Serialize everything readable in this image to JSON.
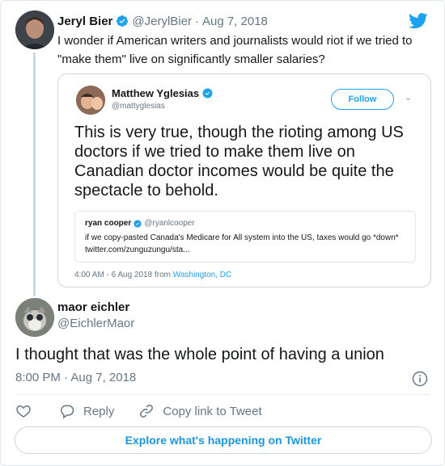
{
  "parent_tweet": {
    "author_name": "Jeryl Bier",
    "handle": "@JerylBier",
    "separator": "·",
    "date": "Aug 7, 2018",
    "text": "I wonder if American writers and journalists would riot if we tried to \"make them\" live on significantly smaller salaries?"
  },
  "quoted_image": {
    "author_name": "Matthew Yglesias",
    "handle": "@mattyglesias",
    "follow_label": "Follow",
    "text": "This is very true, though the rioting among US doctors if we tried to make them live on Canadian doctor incomes would be quite the spectacle to behold.",
    "inner_quote": {
      "author_name": "ryan cooper",
      "handle": "@ryanlcooper",
      "text": "if we copy-pasted Canada's Medicare for All system into the US, taxes would go *down* twitter.com/zunguzungu/sta..."
    },
    "timestamp": "4:00 AM - 6 Aug 2018 from",
    "location": "Washington, DC"
  },
  "main_tweet": {
    "author_name": "maor eichler",
    "handle": "@EichlerMaor",
    "text": "I thought that was the whole point of having a union",
    "timestamp": "8:00 PM · Aug 7, 2018"
  },
  "actions": {
    "reply_label": "Reply",
    "copy_link_label": "Copy link to Tweet"
  },
  "explore_label": "Explore what's happening on Twitter",
  "colors": {
    "brand_blue": "#1da1f2",
    "link_blue": "#1b95e0",
    "secondary_text": "#657786",
    "border": "#ccd6dd"
  }
}
